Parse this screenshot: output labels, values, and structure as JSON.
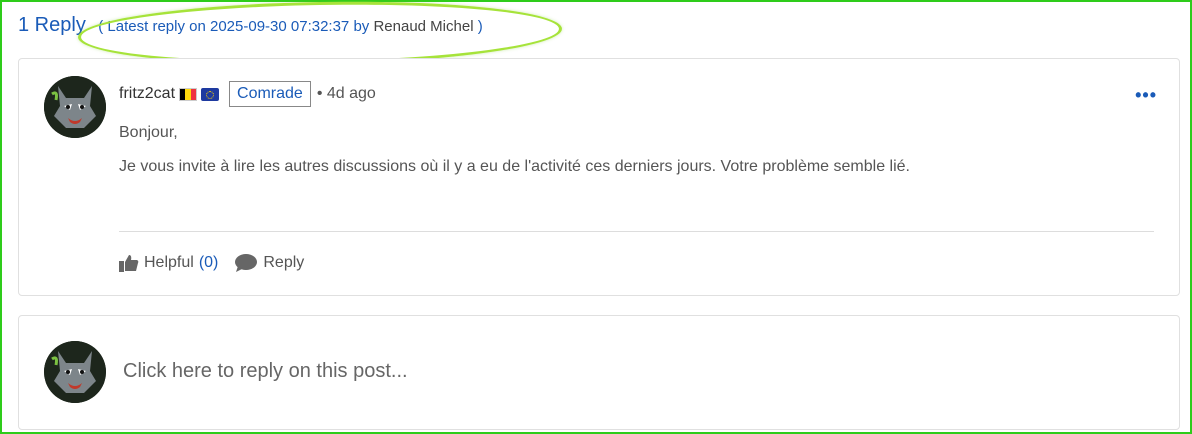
{
  "thread": {
    "reply_count": "1 Reply",
    "latest_prefix": "( Latest reply on 2025-09-30 07:32:37 by",
    "latest_author": "Renaud Michel",
    "latest_suffix": ")"
  },
  "post": {
    "author": "fritz2cat",
    "badge": "Comrade",
    "time": "• 4d ago",
    "more_label": "•••",
    "paragraphs": [
      "Bonjour,",
      "Je vous invite à lire les autres discussions où il y a eu de l'activité ces derniers jours. Votre problème semble lié."
    ],
    "actions": {
      "helpful_label": "Helpful",
      "helpful_count": "(0)",
      "reply_label": "Reply"
    }
  },
  "reply_box": {
    "prompt": "Click here to reply on this post..."
  },
  "colors": {
    "link": "#1a5bb8",
    "frame_border": "#2ecc1a",
    "highlight": "#a6e33a"
  },
  "icons": {
    "thumbs_up": "thumbs-up-icon",
    "comment": "comment-icon",
    "more": "more-dots-icon"
  }
}
